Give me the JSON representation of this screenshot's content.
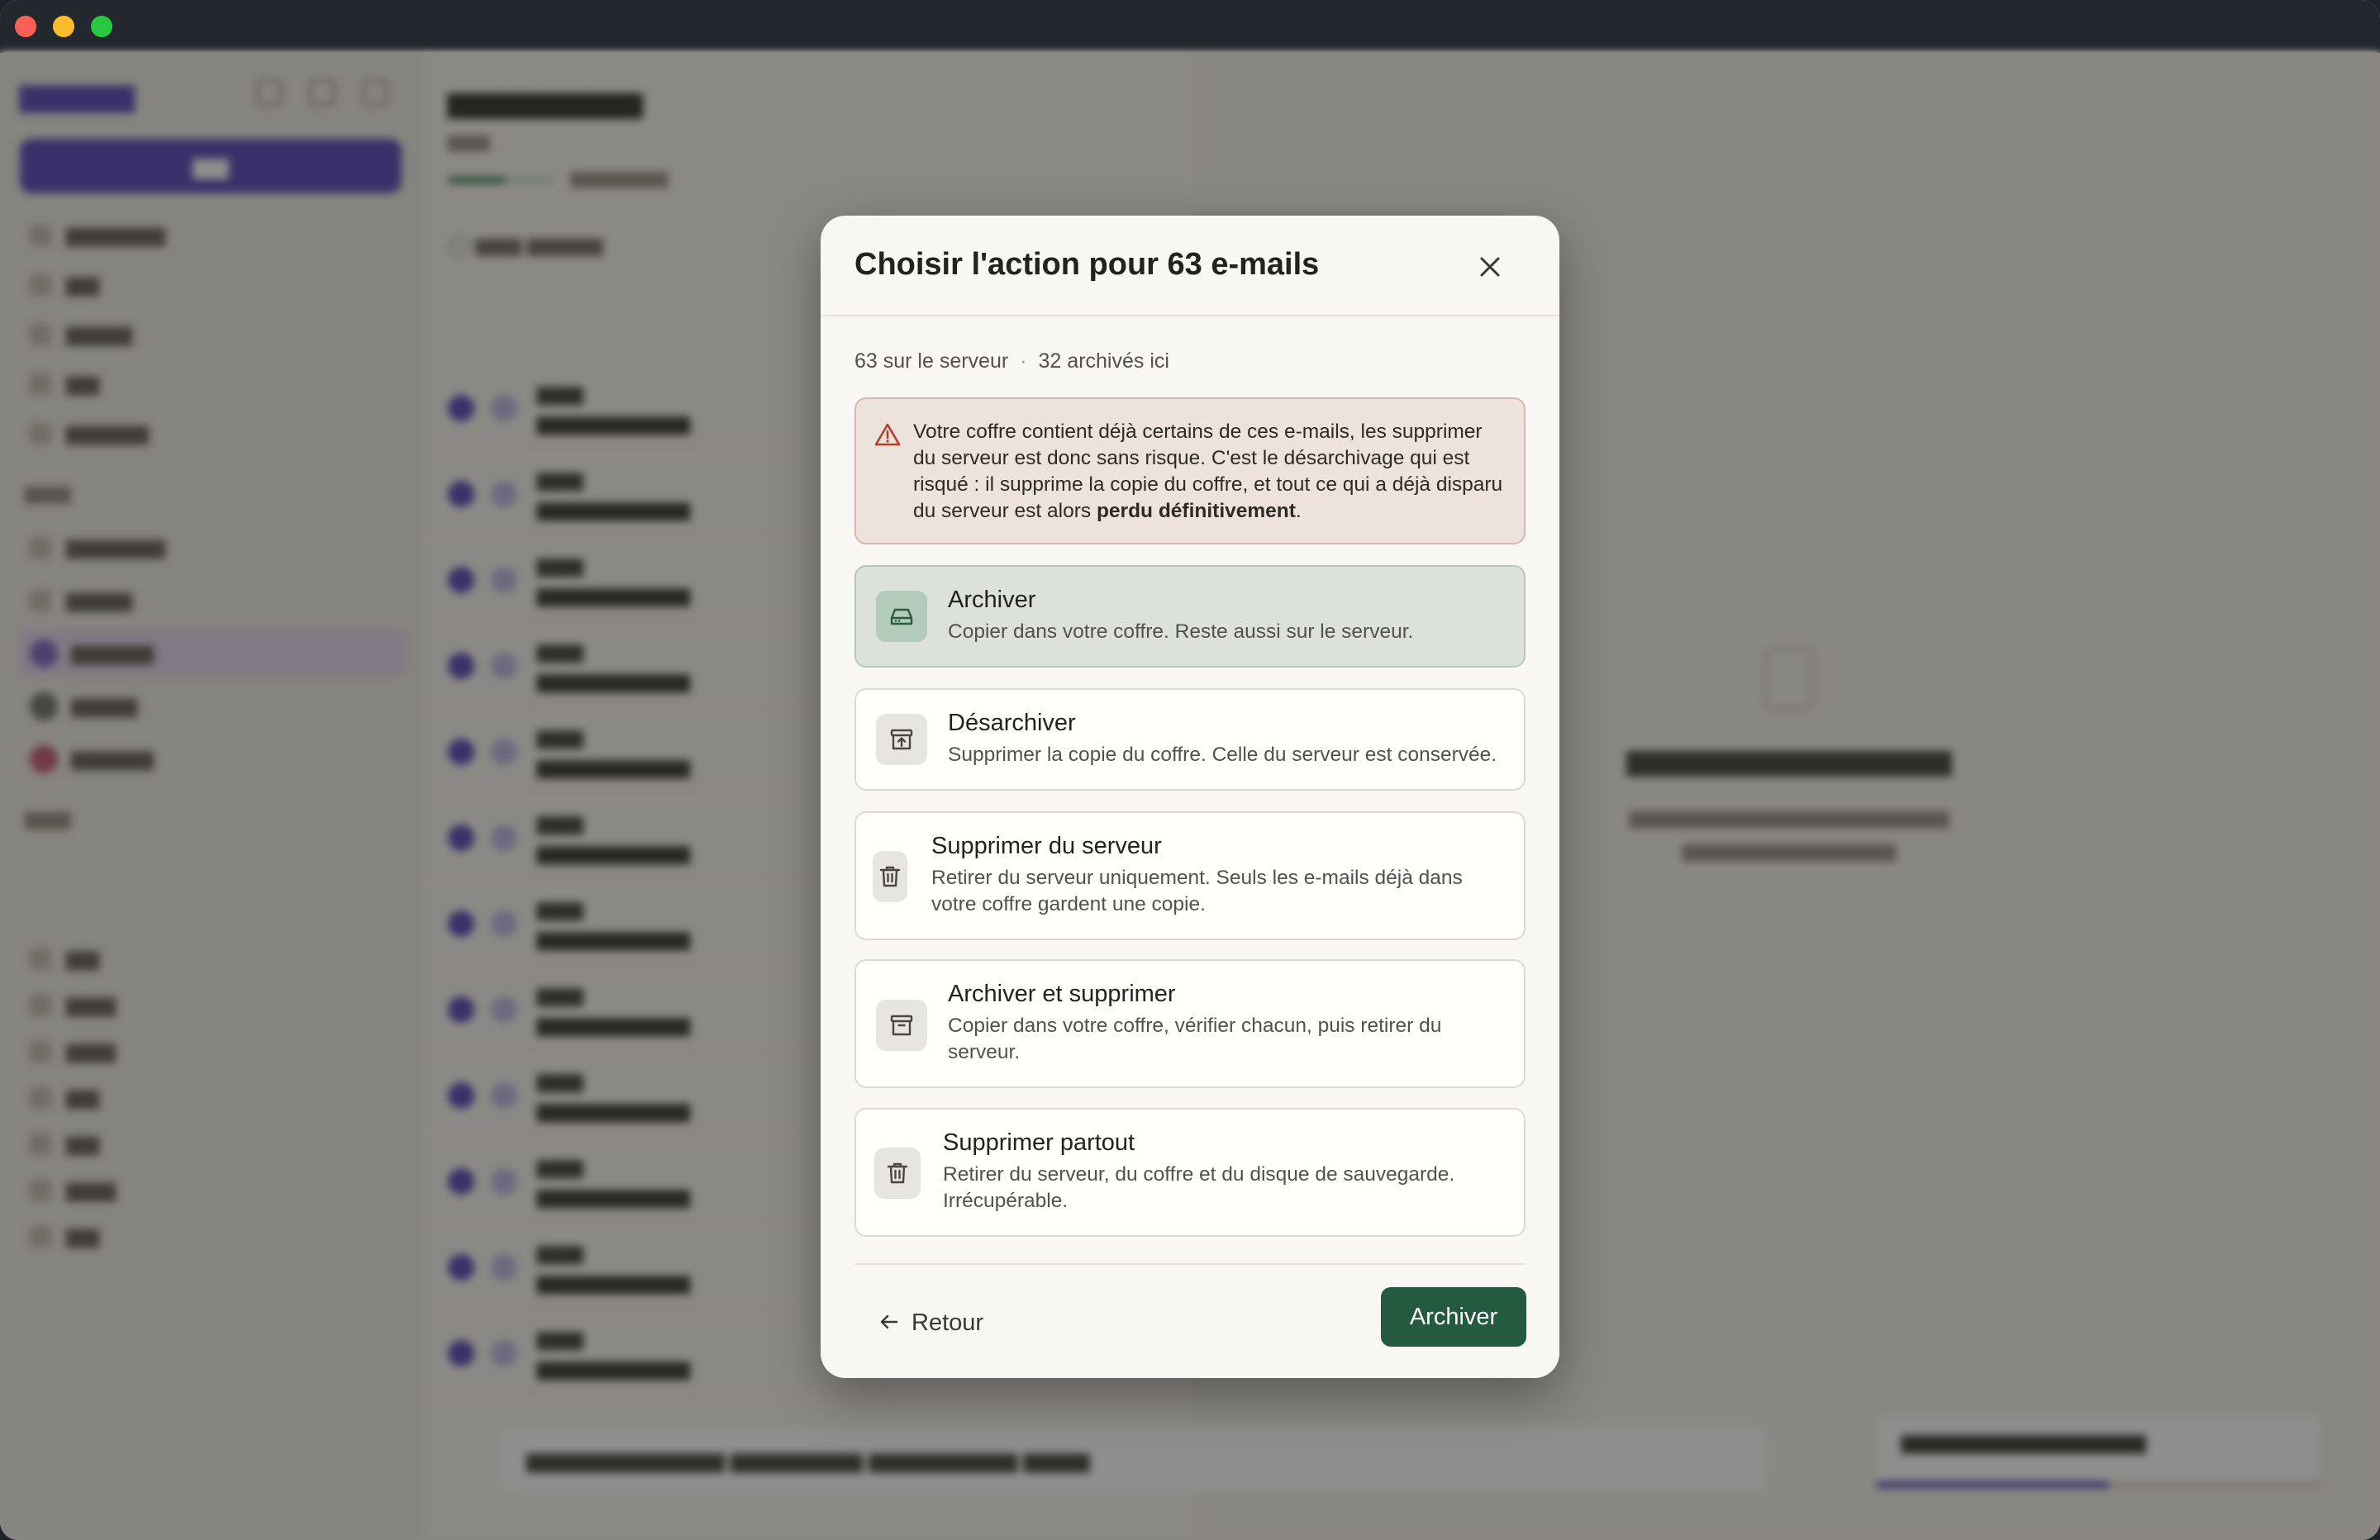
{
  "window": {
    "controls": [
      "close",
      "minimize",
      "maximize"
    ]
  },
  "modal": {
    "title": "Choisir l'action pour 63 e-mails",
    "meta": {
      "server_count": "63 sur le serveur",
      "separator": "·",
      "archived_count": "32 archivés ici"
    },
    "warning": {
      "icon": "warning-triangle-icon",
      "text_before": "Votre coffre contient déjà certains de ces e-mails, les supprimer du serveur est donc sans risque. C'est le désarchivage qui est risqué : il supprime la copie du coffre, et tout ce qui a déjà disparu du serveur est alors ",
      "text_bold": "perdu définitivement",
      "text_after": "."
    },
    "options": [
      {
        "id": "archive",
        "title": "Archiver",
        "description": "Copier dans votre coffre. Reste aussi sur le serveur.",
        "icon": "hard-drive-icon",
        "selected": true
      },
      {
        "id": "unarchive",
        "title": "Désarchiver",
        "description": "Supprimer la copie du coffre. Celle du serveur est conservée.",
        "icon": "unarchive-icon",
        "selected": false
      },
      {
        "id": "delete-server",
        "title": "Supprimer du serveur",
        "description": "Retirer du serveur uniquement. Seuls les e-mails déjà dans votre coffre gardent une copie.",
        "icon": "trash-icon",
        "selected": false
      },
      {
        "id": "archive-delete",
        "title": "Archiver et supprimer",
        "description": "Copier dans votre coffre, vérifier chacun, puis retirer du serveur.",
        "icon": "archive-box-icon",
        "selected": false
      },
      {
        "id": "delete-everywhere",
        "title": "Supprimer partout",
        "description": "Retirer du serveur, du coffre et du disque de sauvegarde. Irrécupérable.",
        "icon": "trash-icon",
        "selected": false
      }
    ],
    "back_label": "Retour",
    "primary_label": "Archiver"
  },
  "colors": {
    "primary": "#245b40",
    "selected_bg": "#dde1dc",
    "warning_bg": "#ede2dc",
    "warning_icon": "#b3402a",
    "brand": "#4b3fb8"
  }
}
